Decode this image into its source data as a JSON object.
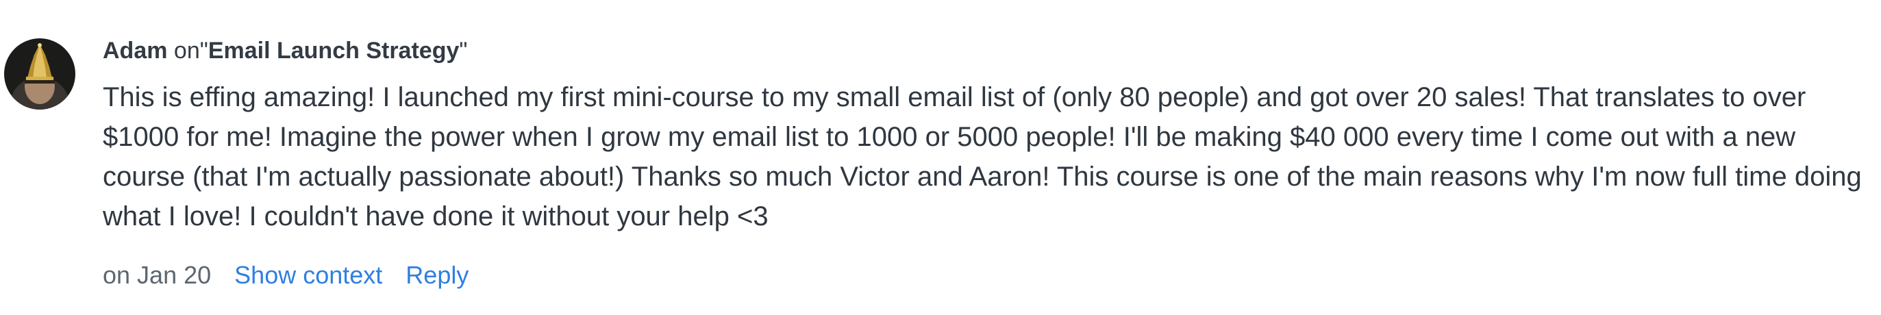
{
  "comment": {
    "author": "Adam",
    "on_word": "on",
    "quote_open": "\"",
    "title": "Email Launch Strategy",
    "quote_close": "\"",
    "body": "This is effing amazing! I launched my first mini-course to my small email list of (only 80 people) and got over 20 sales! That translates to over $1000 for me! Imagine the power when I grow my email list to 1000 or 5000 people! I'll be making $40 000 every time I come out with a new course (that I'm actually passionate about!) Thanks so much Victor and Aaron! This course is one of the main reasons why I'm now full time doing what I love! I couldn't have done it without your help <3",
    "date": "on Jan 20",
    "show_context_label": "Show context",
    "reply_label": "Reply"
  },
  "colors": {
    "text": "#2f3740",
    "muted": "#5c6670",
    "link": "#2f7fe0"
  },
  "icons": {
    "avatar": "user-avatar-photo"
  }
}
